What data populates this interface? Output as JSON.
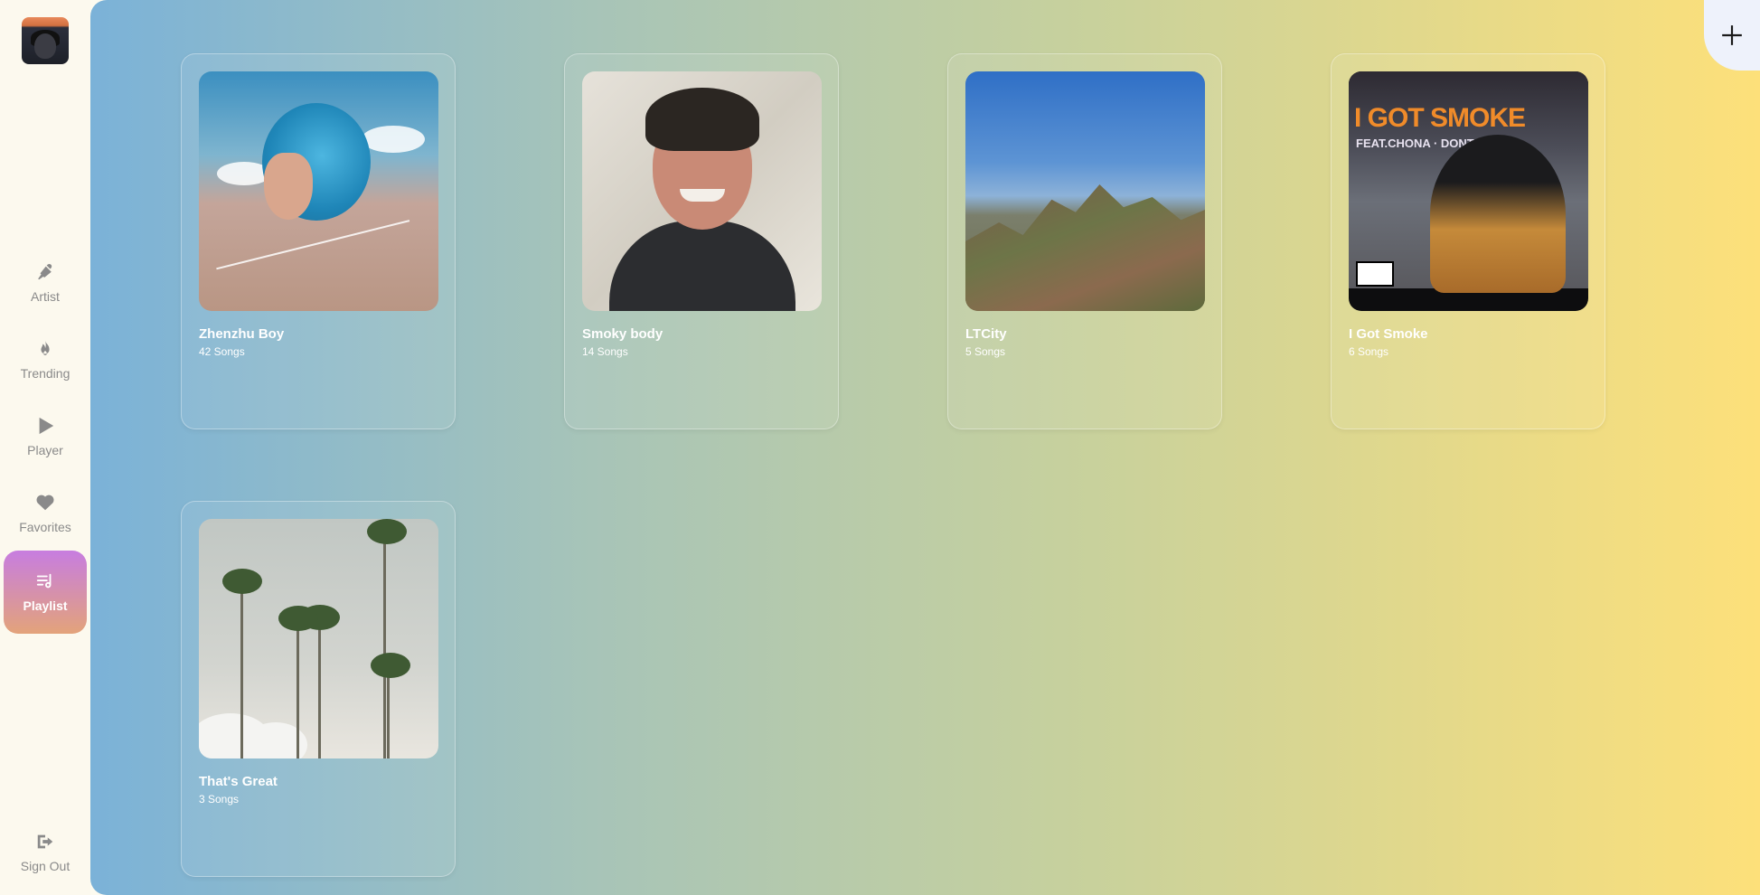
{
  "sidebar": {
    "nav": [
      {
        "label": "Artist",
        "icon": "microphone-icon"
      },
      {
        "label": "Trending",
        "icon": "flame-icon"
      },
      {
        "label": "Player",
        "icon": "play-icon"
      },
      {
        "label": "Favorites",
        "icon": "heart-icon"
      },
      {
        "label": "Playlist",
        "icon": "playlist-icon",
        "active": true
      }
    ],
    "sign_out": {
      "label": "Sign Out",
      "icon": "sign-out-icon"
    }
  },
  "main": {
    "add_button_icon": "plus-icon",
    "playlists": [
      {
        "title": "Zhenzhu Boy",
        "count": "42 Songs"
      },
      {
        "title": "Smoky body",
        "count": "14 Songs"
      },
      {
        "title": "LTCity",
        "count": "5 Songs"
      },
      {
        "title": "I Got Smoke",
        "count": "6 Songs"
      },
      {
        "title": "That's Great",
        "count": "3 Songs"
      }
    ],
    "cover_texts": {
      "i_got_smoke_title": "I GOT SMOKE",
      "i_got_smoke_sub": "FEAT.CHONA · DONTSMOKE"
    }
  },
  "colors": {
    "active_gradient_start": "#c77de0",
    "active_gradient_end": "#e3a37a",
    "main_gradient_start": "#7bb2d8",
    "main_gradient_end": "#fde07a"
  }
}
